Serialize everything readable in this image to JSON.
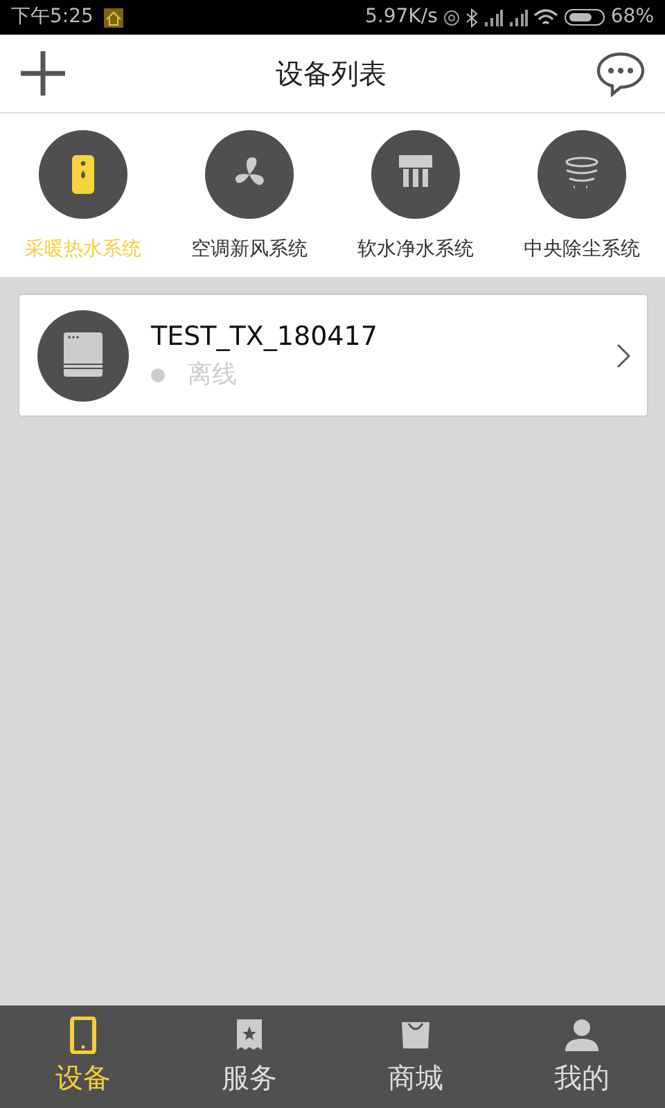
{
  "status_bar": {
    "time": "下午5:25",
    "speed": "5.97K/s",
    "battery": "68%"
  },
  "header": {
    "title": "设备列表"
  },
  "categories": [
    {
      "label": "采暖热水系统",
      "kind": "heater",
      "selected": true
    },
    {
      "label": "空调新风系统",
      "kind": "fan",
      "selected": false
    },
    {
      "label": "软水净水系统",
      "kind": "filter",
      "selected": false
    },
    {
      "label": "中央除尘系统",
      "kind": "dust",
      "selected": false
    }
  ],
  "devices": [
    {
      "name": "TEST_TX_180417",
      "status": "离线",
      "online": false
    }
  ],
  "tabs": [
    {
      "label": "设备",
      "kind": "device",
      "selected": true
    },
    {
      "label": "服务",
      "kind": "service",
      "selected": false
    },
    {
      "label": "商城",
      "kind": "shop",
      "selected": false
    },
    {
      "label": "我的",
      "kind": "mine",
      "selected": false
    }
  ]
}
